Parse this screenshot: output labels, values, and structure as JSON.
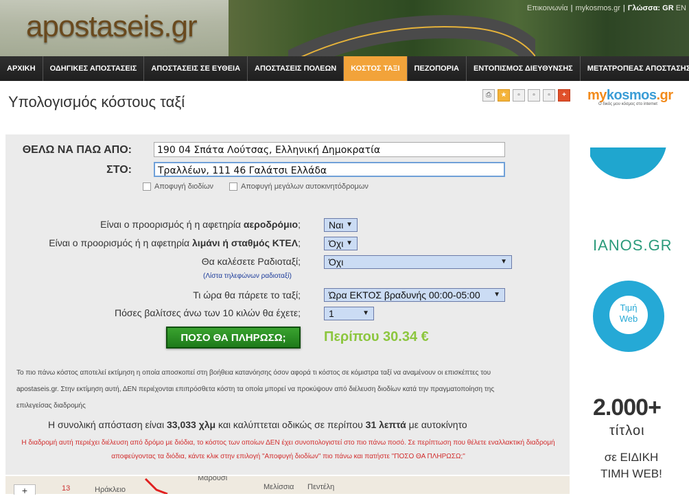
{
  "header": {
    "logo": "apostaseis.gr",
    "links": [
      "Επικοινωνία",
      "mykosmos.gr"
    ],
    "lang_label": "Γλώσσα:",
    "lang_gr": "GR",
    "lang_en": "EN"
  },
  "nav": [
    "ΑΡΧΙΚΗ",
    "ΟΔΗΓΙΚΕΣ ΑΠΟΣΤΑΣΕΙΣ",
    "ΑΠΟΣΤΑΣΕΙΣ ΣΕ ΕΥΘΕΙΑ",
    "ΑΠΟΣΤΑΣΕΙΣ ΠΟΛΕΩΝ",
    "ΚΟΣΤΟΣ ΤΑΞΙ",
    "ΠΕΖΟΠΟΡΙΑ",
    "ΕΝΤΟΠΙΣΜΟΣ ΔΙΕΥΘΥΝΣΗΣ",
    "ΜΕΤΑΤΡΟΠΕΑΣ ΑΠΟΣΤΑΣΗΣ"
  ],
  "nav_active": "ΚΟΣΤΟΣ ΤΑΞΙ",
  "page_title": "Υπολογισμός κόστους ταξί",
  "form": {
    "from_label": "ΘΕΛΩ ΝΑ ΠΑΩ ΑΠΟ:",
    "from_value": "190 04 Σπάτα Λούτσας, Ελληνική Δημοκρατία",
    "to_label": "ΣΤΟ:",
    "to_value": "Τραλλέων, 111 46 Γαλάτσι Ελλάδα",
    "avoid_tolls": "Αποφυγή διοδίων",
    "avoid_highways": "Αποφυγή μεγάλων αυτοκινητόδρομων",
    "q_airport_prefix": "Είναι ο προορισμός ή η αφετηρία",
    "q_airport_bold": "αεροδρόμιο",
    "q_airport_value": "Ναι",
    "q_port_prefix": "Είναι ο προορισμός ή η αφετηρία",
    "q_port_bold": "λιμάνι ή σταθμός ΚΤΕΛ",
    "q_port_value": "Όχι",
    "q_radio": "Θα καλέσετε Ραδιοταξί;",
    "q_radio_value": "Όχι",
    "radio_list_link": "Λίστα τηλεφώνων ραδιοταξί",
    "q_time": "Τι ώρα θα πάρετε το ταξί;",
    "q_time_value": "Ώρα ΕΚΤΟΣ βραδυνής 00:00-05:00",
    "q_luggage": "Πόσες βαλίτσες άνω των 10 κιλών θα έχετε;",
    "q_luggage_value": "1",
    "pay_button": "ΠΟΣΟ ΘΑ ΠΛΗΡΩΣΩ;",
    "price": "Περίπου 30.34 €"
  },
  "disclaimer": "Το πιο πάνω κόστος αποτελεί εκτίμηση η οποία αποσκοπεί στη βοήθεια κατανόησης όσον αφορά τι κόστος σε κόμιστρα ταξί να αναμένουν οι επισκέπτες του apostaseis.gr. Στην εκτίμηση αυτή, ΔΕΝ περιέχονται επιπρόσθετα κόστη τα οποία μπορεί να προκύψουν από διέλευση διοδίων κατά την πραγματοποίηση της επιλεγείσας διαδρομής",
  "summary": {
    "prefix": "Η συνολική απόσταση είναι",
    "distance": "33,033 χλμ",
    "middle": "και καλύπτεται οδικώς σε περίπου",
    "time": "31 λεπτά",
    "suffix": "με αυτοκίνητο"
  },
  "warning": "Η διαδρομή αυτή περιέχει διέλευση από δρόμο με διόδια, το κόστος των οποίων ΔΕΝ έχει συνοπολογιστεί στο πιο πάνω ποσό. Σε περίπτωση που θέλετε εναλλακτική διαδρομή αποφεύγοντας τα διόδια, κάντε κλικ στην επιλογή \"Αποφυγή διοδίων\" πιο πάνω και πατήστε \"ΠΟΣΟ ΘΑ ΠΛΗΡΩΣΩ;\"",
  "map": {
    "labels": [
      "Μαρούσι",
      "Μελίσσια",
      "Πεντέλη",
      "Ηράκλειο",
      "13"
    ],
    "zoom": "+"
  },
  "ads": {
    "mykosmos_a": "my",
    "mykosmos_b": "kosmos",
    "mykosmos_c": ".gr",
    "mykosmos_tagline": "Ο δικός μου κόσμος στο internet",
    "ianos": "IANOS.GR",
    "badge_line1": "Τιμή",
    "badge_line2": "Web",
    "count": "2.000+",
    "titles": "τίτλοι",
    "special_1": "σε ΕΙΔΙΚΗ",
    "special_2": "ΤΙΜΗ WEB!"
  },
  "colors": {
    "nav_active": "#f2a33a",
    "price": "#8cc63e",
    "warning": "#d12b2b",
    "pay_button": "#2a8f24"
  }
}
